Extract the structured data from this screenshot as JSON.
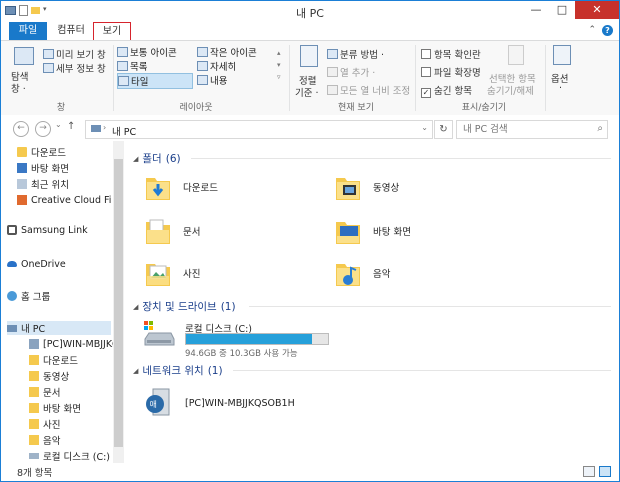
{
  "window": {
    "title": "내 PC",
    "minimize": "—",
    "maximize": "□",
    "close": "✕"
  },
  "tabs": [
    {
      "label": "파일"
    },
    {
      "label": "컴퓨터"
    },
    {
      "label": "보기"
    }
  ],
  "tabs_right": {
    "collapse": "⌃",
    "help": "?"
  },
  "ribbon": {
    "pane": {
      "nav_pane": "탐색",
      "nav_pane2": "창 ·",
      "preview": "미리 보기 창",
      "details": "세부 정보 창",
      "group": "창"
    },
    "layout": {
      "items": [
        "보통 아이콘",
        "작은 아이콘",
        "목록",
        "자세히",
        "타일",
        "내용"
      ],
      "selected": "타일",
      "group": "레이아웃"
    },
    "current_view": {
      "sort": "정렬",
      "sort2": "기준 ·",
      "group_by": "분류 방법 ·",
      "add_col": "열 추가 ·",
      "fit_cols": "모든 열 너비 조정",
      "group": "현재 보기"
    },
    "show_hide": {
      "item_checkbox": "항목 확인란",
      "extensions": "파일 확장명",
      "hidden": "숨긴 항목",
      "hide_selected": "선택한 항목",
      "hide_selected2": "숨기기/해제",
      "group": "표시/숨기기"
    },
    "options": {
      "label": "옵션",
      "arrow": "·"
    }
  },
  "address": {
    "path": "내 PC",
    "search_placeholder": "내 PC 검색",
    "refresh": "↻",
    "back": "←",
    "forward": "→",
    "up": "↑",
    "dropdown": "⌄"
  },
  "nav": [
    {
      "label": "다운로드",
      "icon": "download-folder-icon"
    },
    {
      "label": "바탕 화면",
      "icon": "desktop-icon"
    },
    {
      "label": "최근 위치",
      "icon": "recent-places-icon"
    },
    {
      "label": "Creative Cloud Fi",
      "icon": "creative-cloud-icon"
    },
    {
      "label": "Samsung Link",
      "icon": "samsung-link-icon"
    },
    {
      "label": "OneDrive",
      "icon": "onedrive-icon"
    },
    {
      "label": "홈 그룹",
      "icon": "homegroup-icon"
    },
    {
      "label": "내 PC",
      "icon": "this-pc-icon"
    },
    {
      "label": "[PC]WIN-MBJJKQ",
      "icon": "network-pc-icon"
    },
    {
      "label": "다운로드",
      "icon": "download-folder-icon"
    },
    {
      "label": "동영상",
      "icon": "videos-folder-icon"
    },
    {
      "label": "문서",
      "icon": "documents-folder-icon"
    },
    {
      "label": "바탕 화면",
      "icon": "desktop-icon"
    },
    {
      "label": "사진",
      "icon": "pictures-folder-icon"
    },
    {
      "label": "음악",
      "icon": "music-folder-icon"
    },
    {
      "label": "로컬 디스크 (C:)",
      "icon": "local-disk-icon"
    }
  ],
  "sections": {
    "folders": {
      "title": "폴더",
      "count": "(6)"
    },
    "drives": {
      "title": "장치 및 드라이브",
      "count": "(1)"
    },
    "network": {
      "title": "네트워크 위치",
      "count": "(1)"
    }
  },
  "folders": [
    {
      "label": "다운로드",
      "icon": "download-folder-icon"
    },
    {
      "label": "동영상",
      "icon": "videos-folder-icon"
    },
    {
      "label": "문서",
      "icon": "documents-folder-icon"
    },
    {
      "label": "바탕 화면",
      "icon": "desktop-folder-icon"
    },
    {
      "label": "사진",
      "icon": "pictures-folder-icon"
    },
    {
      "label": "음악",
      "icon": "music-folder-icon"
    }
  ],
  "drive": {
    "label": "로컬 디스크 (C:)",
    "space": "94.6GB 중 10.3GB 사용 가능",
    "used_fraction": 0.89
  },
  "network_location": {
    "label": "[PC]WIN-MBJJKQSOB1H"
  },
  "status": {
    "count": "8개 항목"
  },
  "colors": {
    "accent": "#1979ca",
    "close": "#c7312b",
    "drive_fill": "#26a0da",
    "folder": "#f5c94e"
  }
}
